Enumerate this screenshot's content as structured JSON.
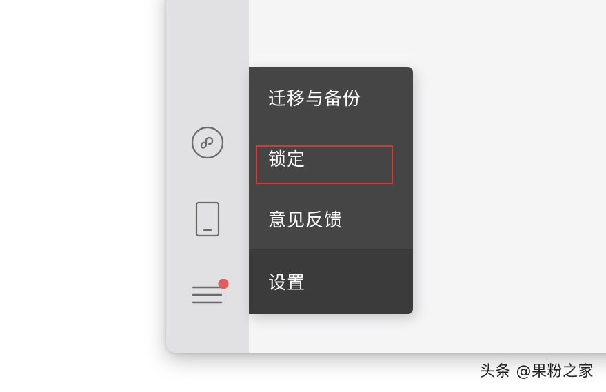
{
  "sidebar": {
    "icons": [
      {
        "name": "mini-program-icon"
      },
      {
        "name": "phone-icon"
      },
      {
        "name": "menu-icon",
        "badge": true
      }
    ]
  },
  "menu": {
    "items": [
      {
        "label": "迁移与备份",
        "badge": true
      },
      {
        "label": "锁定",
        "highlighted": true
      },
      {
        "label": "意见反馈"
      },
      {
        "label": "设置"
      }
    ]
  },
  "watermark": "头条 @果粉之家",
  "colors": {
    "menu_bg": "#454545",
    "badge": "#e35d5d",
    "highlight_border": "#d9372f",
    "sidebar_bg": "#e1e1e3"
  }
}
